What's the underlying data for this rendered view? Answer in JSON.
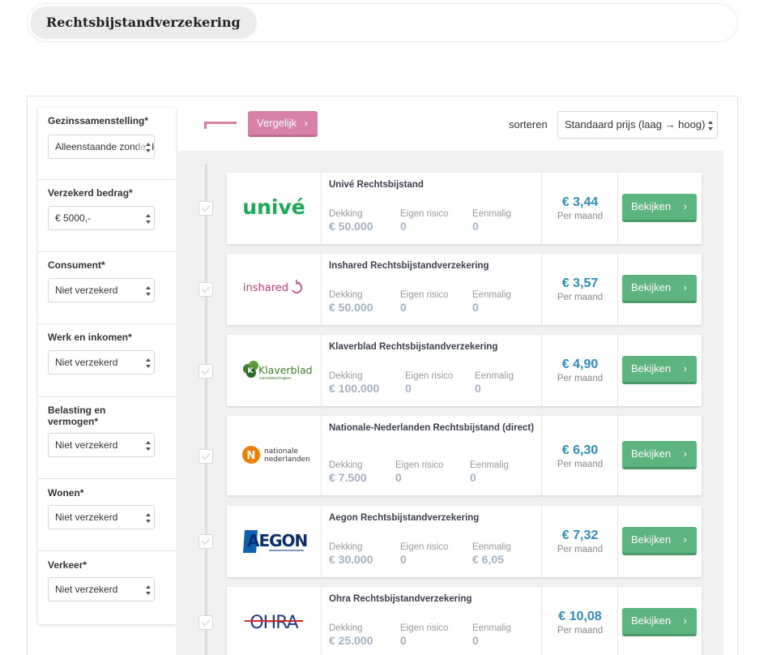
{
  "tab": {
    "label": "Rechtsbijstandverzekering"
  },
  "filters": [
    {
      "label": "Gezinssamenstelling*",
      "value": "Alleenstaande zonder kinderen"
    },
    {
      "label": "Verzekerd bedrag*",
      "value": "€ 5000,-"
    },
    {
      "label": "Consument*",
      "value": "Niet verzekerd"
    },
    {
      "label": "Werk en inkomen*",
      "value": "Niet verzekerd"
    },
    {
      "label": "Belasting en vermogen*",
      "value": "Niet verzekerd"
    },
    {
      "label": "Wonen*",
      "value": "Niet verzekerd"
    },
    {
      "label": "Verkeer*",
      "value": "Niet verzekerd"
    }
  ],
  "toolbar": {
    "compare_label": "Vergelijk",
    "sort_label": "sorteren",
    "sort_value": "Standaard prijs (laag → hoog)"
  },
  "labels": {
    "dekking": "Dekking",
    "eigen_risico": "Eigen risico",
    "eenmalig": "Eenmalig",
    "per_maand": "Per maand",
    "view": "Bekijken"
  },
  "results": [
    {
      "name": "Univé Rechtsbijstand",
      "dekking": "€ 50.000",
      "eigen_risico": "0",
      "eenmalig": "0",
      "price": "€ 3,44",
      "logo_text": "univé",
      "logo_color": "#1aab55"
    },
    {
      "name": "Inshared Rechtsbijstandverzekering",
      "dekking": "€ 50.000",
      "eigen_risico": "0",
      "eenmalig": "0",
      "price": "€ 3,57",
      "logo_text": "inshared",
      "logo_color": "#c23b7a"
    },
    {
      "name": "Klaverblad Rechtsbijstandverzekering",
      "dekking": "€ 100.000",
      "eigen_risico": "0",
      "eenmalig": "0",
      "price": "€ 4,90",
      "logo_text": "Klaverblad",
      "logo_sub": "verzekeringen",
      "logo_color": "#3d7d2e"
    },
    {
      "name": "Nationale-Nederlanden Rechtsbijstand (direct)",
      "dekking": "€ 7.500",
      "eigen_risico": "0",
      "eenmalig": "0",
      "price": "€ 6,30",
      "logo_text": "nationale",
      "logo_sub": "nederlanden",
      "logo_color": "#ee7f00"
    },
    {
      "name": "Aegon Rechtsbijstandverzekering",
      "dekking": "€ 30.000",
      "eigen_risico": "0",
      "eenmalig": "€ 6,05",
      "price": "€ 7,32",
      "logo_text": "AEGON",
      "logo_color": "#0a2f6e"
    },
    {
      "name": "Ohra Rechtsbijstandverzekering",
      "dekking": "€ 25.000",
      "eigen_risico": "0",
      "eenmalig": "0",
      "price": "€ 10,08",
      "logo_text": "OHRA",
      "logo_color": "#1b3a8a"
    }
  ]
}
